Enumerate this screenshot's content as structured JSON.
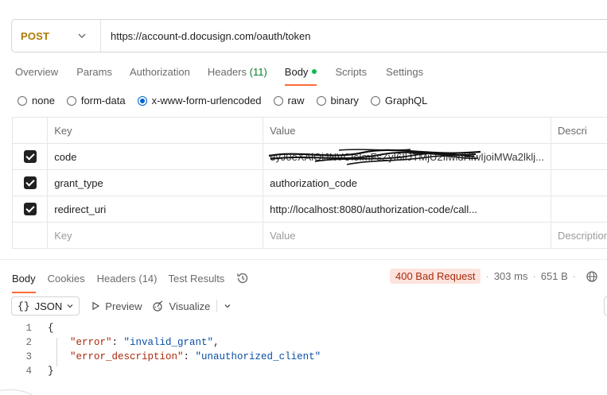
{
  "request": {
    "method": "POST",
    "url": "https://account-d.docusign.com/oauth/token"
  },
  "tabs": [
    {
      "label": "Overview"
    },
    {
      "label": "Params"
    },
    {
      "label": "Authorization"
    },
    {
      "label": "Headers",
      "count": "(11)"
    },
    {
      "label": "Body"
    },
    {
      "label": "Scripts"
    },
    {
      "label": "Settings"
    }
  ],
  "body_types": {
    "options": [
      "none",
      "form-data",
      "x-www-form-urlencoded",
      "raw",
      "binary",
      "GraphQL"
    ],
    "selected": "x-www-form-urlencoded"
  },
  "table": {
    "headers": {
      "key": "Key",
      "value": "Value",
      "description": "Descri"
    },
    "rows": [
      {
        "key": "code",
        "value": "eyJ0eXAiOiJNVCIsImFsZyI6IlJTMjU2IiwidHlwIjoiMWa2lklj...",
        "checked": true
      },
      {
        "key": "grant_type",
        "value": "authorization_code",
        "checked": true
      },
      {
        "key": "redirect_uri",
        "value": "http://localhost:8080/authorization-code/call...",
        "checked": true
      }
    ],
    "placeholder": {
      "key": "Key",
      "value": "Value",
      "description": "Description"
    }
  },
  "response": {
    "tabs": [
      {
        "label": "Body"
      },
      {
        "label": "Cookies"
      },
      {
        "label": "Headers",
        "count": "(14)"
      },
      {
        "label": "Test Results"
      }
    ],
    "status": "400 Bad Request",
    "time": "303 ms",
    "size": "651 B",
    "format": "JSON",
    "format_braces": "{}",
    "preview_label": "Preview",
    "visualize_label": "Visualize",
    "code_lines": [
      {
        "num": "1",
        "text": "{"
      },
      {
        "num": "2",
        "key": "\"error\"",
        "sep": ": ",
        "value": "\"invalid_grant\"",
        "trail": ","
      },
      {
        "num": "3",
        "key": "\"error_description\"",
        "sep": ": ",
        "value": "\"unauthorized_client\"",
        "trail": ""
      },
      {
        "num": "4",
        "text": "}"
      }
    ]
  },
  "colors": {
    "method": "#ad7a03",
    "accent": "#ff6c37",
    "status_bg": "#fde3dd",
    "status_fg": "#a82a0c",
    "radio_selected": "#0265d2"
  }
}
